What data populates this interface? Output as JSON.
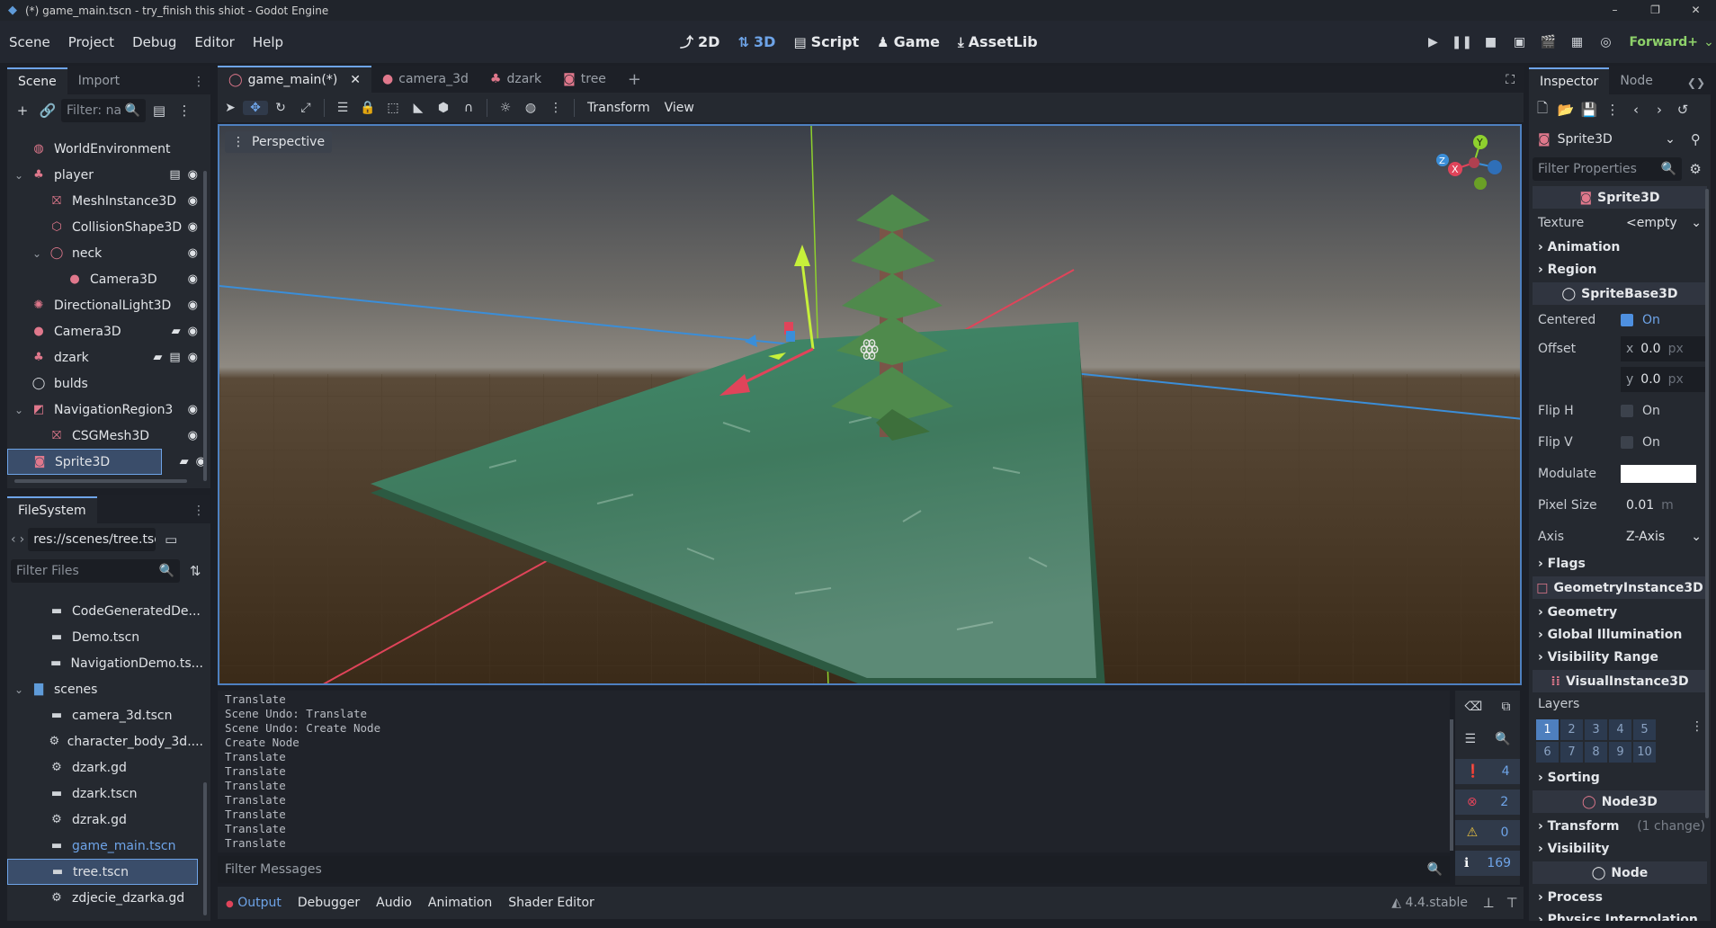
{
  "window": {
    "title": "(*) game_main.tscn - try_finish this shiot - Godot Engine",
    "min": "–",
    "max": "❐",
    "close": "✕"
  },
  "menu": [
    "Scene",
    "Project",
    "Debug",
    "Editor",
    "Help"
  ],
  "workspaces": [
    {
      "label": "2D",
      "icon": "2d-icon"
    },
    {
      "label": "3D",
      "icon": "3d-icon",
      "active": true
    },
    {
      "label": "Script",
      "icon": "script-icon"
    },
    {
      "label": "Game",
      "icon": "game-icon"
    },
    {
      "label": "AssetLib",
      "icon": "assetlib-icon"
    }
  ],
  "renderer": "Forward+",
  "scene_dock": {
    "tabs": [
      "Scene",
      "Import"
    ],
    "filter_placeholder": "Filter: na",
    "nodes": [
      {
        "label": "WorldEnvironment",
        "indent": 1,
        "icon": "world-environment-icon",
        "color": "#e0788c"
      },
      {
        "label": "player",
        "indent": 1,
        "icon": "character-body-icon",
        "color": "#e0788c",
        "expand": "v",
        "extras": [
          "script-icon",
          "eye-icon"
        ]
      },
      {
        "label": "MeshInstance3D",
        "indent": 2,
        "icon": "mesh-instance-icon",
        "color": "#e0788c",
        "extras": [
          "eye-icon"
        ]
      },
      {
        "label": "CollisionShape3D",
        "indent": 2,
        "icon": "collision-shape-icon",
        "color": "#e0788c",
        "extras": [
          "eye-icon"
        ]
      },
      {
        "label": "neck",
        "indent": 2,
        "icon": "node3d-icon",
        "color": "#e0788c",
        "expand": "v",
        "extras": [
          "eye-icon"
        ]
      },
      {
        "label": "Camera3D",
        "indent": 3,
        "icon": "camera-icon",
        "color": "#e0788c",
        "extras": [
          "eye-icon"
        ]
      },
      {
        "label": "DirectionalLight3D",
        "indent": 1,
        "icon": "light-icon",
        "color": "#e0788c",
        "extras": [
          "eye-icon"
        ]
      },
      {
        "label": "Camera3D",
        "indent": 1,
        "icon": "camera-icon",
        "color": "#e0788c",
        "extras": [
          "clapper-icon",
          "eye-icon"
        ]
      },
      {
        "label": "dzark",
        "indent": 1,
        "icon": "character-body-icon",
        "color": "#e0788c",
        "extras": [
          "clapper-icon",
          "script-icon",
          "eye-icon"
        ]
      },
      {
        "label": "bulds",
        "indent": 1,
        "icon": "node3d-icon",
        "color": "#e1e4e8"
      },
      {
        "label": "NavigationRegion3",
        "indent": 1,
        "icon": "navigation-region-icon",
        "color": "#e0788c",
        "expand": "v",
        "extras": [
          "eye-icon"
        ]
      },
      {
        "label": "CSGMesh3D",
        "indent": 2,
        "icon": "csg-mesh-icon",
        "color": "#e0788c",
        "extras": [
          "eye-icon"
        ]
      },
      {
        "label": "Sprite3D",
        "indent": 1,
        "icon": "sprite3d-icon",
        "color": "#e0788c",
        "selected": true,
        "extras": [
          "clapper-icon",
          "eye-icon"
        ]
      }
    ]
  },
  "filesystem": {
    "tab": "FileSystem",
    "path": "res://scenes/tree.tsc",
    "filter_placeholder": "Filter Files",
    "items": [
      {
        "label": "CodeGeneratedDe...",
        "indent": 2,
        "icon": "scene-file-icon"
      },
      {
        "label": "Demo.tscn",
        "indent": 2,
        "icon": "scene-file-icon"
      },
      {
        "label": "NavigationDemo.ts...",
        "indent": 2,
        "icon": "scene-file-icon"
      },
      {
        "label": "scenes",
        "indent": 1,
        "icon": "folder-icon",
        "expand": "v"
      },
      {
        "label": "camera_3d.tscn",
        "indent": 2,
        "icon": "scene-file-icon"
      },
      {
        "label": "character_body_3d....",
        "indent": 2,
        "icon": "gear-file-icon"
      },
      {
        "label": "dzark.gd",
        "indent": 2,
        "icon": "gear-file-icon"
      },
      {
        "label": "dzark.tscn",
        "indent": 2,
        "icon": "scene-file-icon"
      },
      {
        "label": "dzrak.gd",
        "indent": 2,
        "icon": "gear-file-icon"
      },
      {
        "label": "game_main.tscn",
        "indent": 2,
        "icon": "scene-file-icon",
        "highlight": true
      },
      {
        "label": "tree.tscn",
        "indent": 2,
        "icon": "scene-file-icon",
        "selected": true
      },
      {
        "label": "zdjecie_dzarka.gd",
        "indent": 2,
        "icon": "gear-file-icon"
      }
    ]
  },
  "editor_tabs": [
    {
      "label": "game_main(*)",
      "active": true
    },
    {
      "label": "camera_3d"
    },
    {
      "label": "dzark"
    },
    {
      "label": "tree"
    }
  ],
  "viewport_toolbar": {
    "transform": "Transform",
    "view": "View"
  },
  "viewport": {
    "perspective": "Perspective",
    "gizmo": {
      "y": "Y",
      "x": "X",
      "z": "Z"
    }
  },
  "console": {
    "lines": [
      "Translate",
      "Scene Undo: Translate",
      "Scene Undo: Create Node",
      "Create Node",
      "Translate",
      "Translate",
      "Translate",
      "Translate",
      "Translate",
      "Translate",
      "Translate"
    ],
    "filter_placeholder": "Filter Messages",
    "counts": {
      "messages": "4",
      "errors": "2",
      "warnings": "0",
      "info": "169"
    }
  },
  "bottom_tabs": [
    "Output",
    "Debugger",
    "Audio",
    "Animation",
    "Shader Editor"
  ],
  "version": "4.4.stable",
  "inspector": {
    "tabs": [
      "Inspector",
      "Node"
    ],
    "node_name": "Sprite3D",
    "filter_placeholder": "Filter Properties",
    "class_sprite3d": "Sprite3D",
    "texture_label": "Texture",
    "texture_value": "<empty",
    "animation": "Animation",
    "region": "Region",
    "class_spritebase": "SpriteBase3D",
    "centered_label": "Centered",
    "centered_value": "On",
    "offset_label": "Offset",
    "offset_x": "0.0",
    "offset_y": "0.0",
    "unit_px": "px",
    "flip_h_label": "Flip H",
    "flip_h_value": "On",
    "flip_v_label": "Flip V",
    "flip_v_value": "On",
    "modulate_label": "Modulate",
    "modulate_color": "#ffffff",
    "pixel_size_label": "Pixel Size",
    "pixel_size_value": "0.01",
    "unit_m": "m",
    "axis_label": "Axis",
    "axis_value": "Z-Axis",
    "flags": "Flags",
    "class_geometry": "GeometryInstance3D",
    "geometry": "Geometry",
    "gi": "Global Illumination",
    "visibility_range": "Visibility Range",
    "class_visual": "VisualInstance3D",
    "layers_label": "Layers",
    "layers": [
      "1",
      "2",
      "3",
      "4",
      "5",
      "6",
      "7",
      "8",
      "9",
      "10"
    ],
    "sorting": "Sorting",
    "class_node3d": "Node3D",
    "transform": "Transform",
    "transform_note": "(1 change)",
    "visibility": "Visibility",
    "class_node": "Node",
    "process": "Process",
    "physics_interpolation": "Physics Interpolation"
  }
}
